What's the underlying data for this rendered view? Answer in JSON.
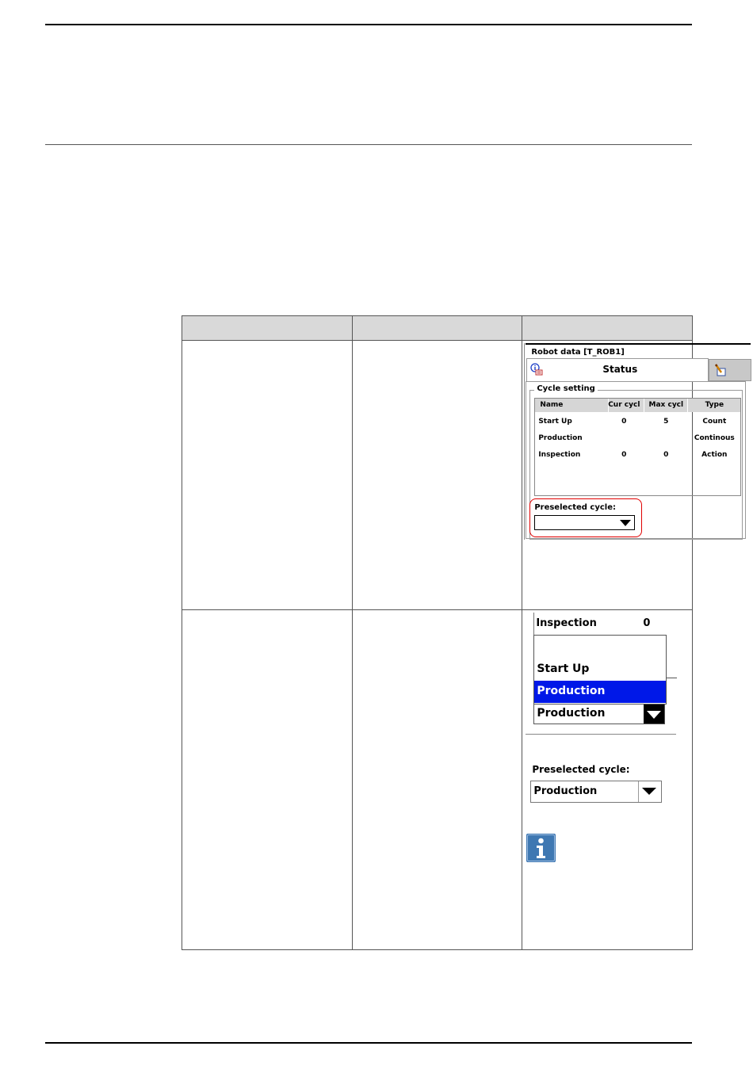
{
  "table": {
    "headers": [
      "",
      "",
      ""
    ]
  },
  "robot_status": {
    "window_title": "Robot data [T_ROB1]",
    "tab_status": "Status",
    "icon_info": "info-icon",
    "icon_tab2": "edit-icon",
    "group_label": "Cycle setting",
    "columns": [
      "Name",
      "Cur cycl",
      "Max cycl",
      "Type"
    ],
    "rows": [
      {
        "name": "Start Up",
        "cur": "0",
        "max": "5",
        "type": "Count"
      },
      {
        "name": "Production",
        "cur": "",
        "max": "",
        "type": "Continous"
      },
      {
        "name": "Inspection",
        "cur": "0",
        "max": "0",
        "type": "Action"
      }
    ],
    "preselected_label": "Preselected cycle:",
    "preselected_value": "",
    "highlight_color": "#e00000"
  },
  "dropdown_open": {
    "above_row_name": "Inspection",
    "above_row_value": "0",
    "options": [
      "Start Up",
      "Production"
    ],
    "selected_option": "Production",
    "current_value": "Production",
    "selection_color": "#0018e8"
  },
  "result": {
    "preselected_label": "Preselected cycle:",
    "preselected_value": "Production",
    "note_icon": "info-icon",
    "note_color": "#3f78b2"
  }
}
